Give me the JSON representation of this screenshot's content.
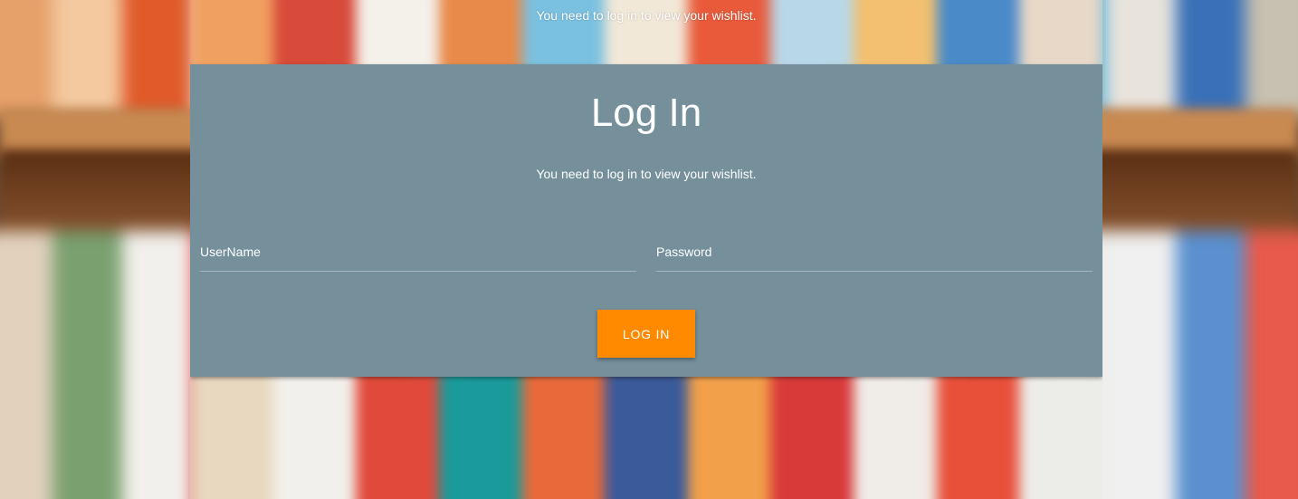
{
  "notice": {
    "text": "You need to log in to view your wishlist."
  },
  "login_card": {
    "title": "Log In",
    "subtitle": "You need to log in to view your wishlist.",
    "username": {
      "placeholder": "UserName",
      "value": ""
    },
    "password": {
      "placeholder": "Password",
      "value": ""
    },
    "submit_label": "LOG IN"
  },
  "colors": {
    "card_background": "#758f9b",
    "button_accent": "#ff8a00",
    "text": "#ffffff"
  },
  "background": {
    "image_semantic": "blurred-bookshelf-photo"
  }
}
